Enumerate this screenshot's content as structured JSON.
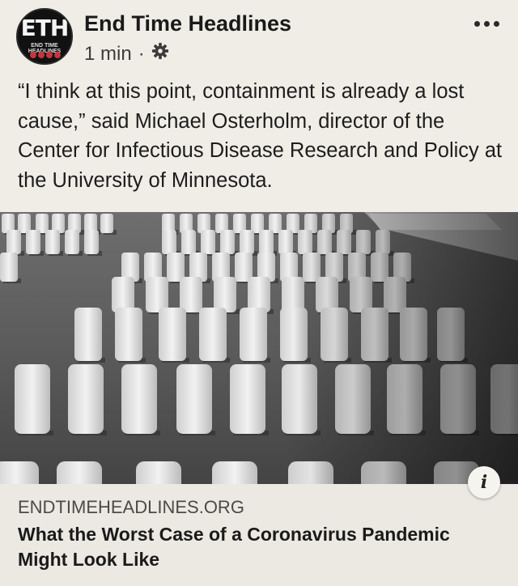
{
  "post": {
    "page_name": "End Time Headlines",
    "avatar_text": "ETH",
    "avatar_subtext": "END TIME HEADLINES",
    "timestamp": "1 min",
    "separator": "·",
    "audience_icon": "gear-icon",
    "menu_icon": "more-options-icon",
    "text": "“I think at this point, containment is already a lost cause,” said Michael Osterholm, director of the Center for Infectious Disease Research and Policy at the University of Minnesota."
  },
  "link_preview": {
    "domain": "ENDTIMEHEADLINES.ORG",
    "title": "What the Worst Case of a Coronavirus Pandemic Might Look Like",
    "info_icon": "info-icon",
    "info_glyph": "i"
  },
  "colors": {
    "background": "#efede6",
    "card": "#ebe9e1",
    "brand_red": "#c8343a"
  }
}
